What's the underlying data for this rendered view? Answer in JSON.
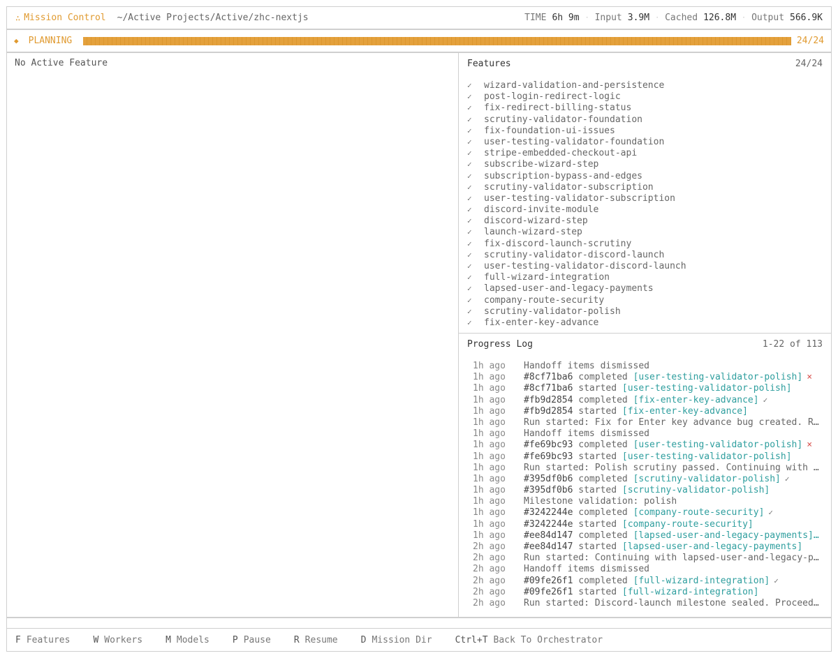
{
  "header": {
    "app_title": "Mission Control",
    "path": "~/Active Projects/Active/zhc-nextjs",
    "stats": [
      {
        "label": "TIME",
        "value": "6h 9m"
      },
      {
        "label": "Input",
        "value": "3.9M"
      },
      {
        "label": "Cached",
        "value": "126.8M"
      },
      {
        "label": "Output",
        "value": "566.9K"
      }
    ]
  },
  "planning": {
    "phase": "PLANNING",
    "count": "24/24",
    "progress": 1.0,
    "color": "#e09a30"
  },
  "left_panel": {
    "title": "No Active Feature"
  },
  "features": {
    "title": "Features",
    "count": "24/24",
    "items": [
      "wizard-validation-and-persistence",
      "post-login-redirect-logic",
      "fix-redirect-billing-status",
      "scrutiny-validator-foundation",
      "fix-foundation-ui-issues",
      "user-testing-validator-foundation",
      "stripe-embedded-checkout-api",
      "subscribe-wizard-step",
      "subscription-bypass-and-edges",
      "scrutiny-validator-subscription",
      "user-testing-validator-subscription",
      "discord-invite-module",
      "discord-wizard-step",
      "launch-wizard-step",
      "fix-discord-launch-scrutiny",
      "scrutiny-validator-discord-launch",
      "user-testing-validator-discord-launch",
      "full-wizard-integration",
      "lapsed-user-and-legacy-payments",
      "company-route-security",
      "scrutiny-validator-polish",
      "fix-enter-key-advance"
    ]
  },
  "progress_log": {
    "title": "Progress Log",
    "range": "1-22 of 113",
    "entries": [
      {
        "time": "1h ago",
        "text": "Handoff items dismissed"
      },
      {
        "time": "1h ago",
        "hash": "#8cf71ba6",
        "action": "completed",
        "feature": "[user-testing-validator-polish]",
        "status": "fail"
      },
      {
        "time": "1h ago",
        "hash": "#8cf71ba6",
        "action": "started",
        "feature": "[user-testing-validator-polish]"
      },
      {
        "time": "1h ago",
        "hash": "#fb9d2854",
        "action": "completed",
        "feature": "[fix-enter-key-advance]",
        "status": "ok"
      },
      {
        "time": "1h ago",
        "hash": "#fb9d2854",
        "action": "started",
        "feature": "[fix-enter-key-advance]"
      },
      {
        "time": "1h ago",
        "text": "Run started: Fix for Enter key advance bug created. R…"
      },
      {
        "time": "1h ago",
        "text": "Handoff items dismissed"
      },
      {
        "time": "1h ago",
        "hash": "#fe69bc93",
        "action": "completed",
        "feature": "[user-testing-validator-polish]",
        "status": "fail"
      },
      {
        "time": "1h ago",
        "hash": "#fe69bc93",
        "action": "started",
        "feature": "[user-testing-validator-polish]"
      },
      {
        "time": "1h ago",
        "text": "Run started: Polish scrutiny passed. Continuing with …"
      },
      {
        "time": "1h ago",
        "hash": "#395df0b6",
        "action": "completed",
        "feature": "[scrutiny-validator-polish]",
        "status": "ok"
      },
      {
        "time": "1h ago",
        "hash": "#395df0b6",
        "action": "started",
        "feature": "[scrutiny-validator-polish]"
      },
      {
        "time": "1h ago",
        "text": "Milestone validation: polish"
      },
      {
        "time": "1h ago",
        "hash": "#3242244e",
        "action": "completed",
        "feature": "[company-route-security]",
        "status": "ok"
      },
      {
        "time": "1h ago",
        "hash": "#3242244e",
        "action": "started",
        "feature": "[company-route-security]"
      },
      {
        "time": "1h ago",
        "hash": "#ee84d147",
        "action": "completed",
        "feature": "[lapsed-user-and-legacy-payments]…"
      },
      {
        "time": "2h ago",
        "hash": "#ee84d147",
        "action": "started",
        "feature": "[lapsed-user-and-legacy-payments]"
      },
      {
        "time": "2h ago",
        "text": "Run started: Continuing with lapsed-user-and-legacy-p…"
      },
      {
        "time": "2h ago",
        "text": "Handoff items dismissed"
      },
      {
        "time": "2h ago",
        "hash": "#09fe26f1",
        "action": "completed",
        "feature": "[full-wizard-integration]",
        "status": "ok"
      },
      {
        "time": "2h ago",
        "hash": "#09fe26f1",
        "action": "started",
        "feature": "[full-wizard-integration]"
      },
      {
        "time": "2h ago",
        "text": "Run started: Discord-launch milestone sealed. Proceed…"
      }
    ]
  },
  "footer": {
    "shortcuts": [
      {
        "key": "F",
        "label": "Features"
      },
      {
        "key": "W",
        "label": "Workers"
      },
      {
        "key": "M",
        "label": "Models"
      },
      {
        "key": "P",
        "label": "Pause"
      },
      {
        "key": "R",
        "label": "Resume"
      },
      {
        "key": "D",
        "label": "Mission Dir"
      },
      {
        "key": "Ctrl+T",
        "label": "Back To Orchestrator"
      }
    ]
  },
  "icons": {
    "logo": "mission-logo-icon",
    "check": "check-icon",
    "fail": "x-icon",
    "phase": "diamond-icon"
  },
  "colors": {
    "accent": "#e09a30",
    "feature_ref": "#2e9e9e",
    "fail": "#d9534f"
  }
}
